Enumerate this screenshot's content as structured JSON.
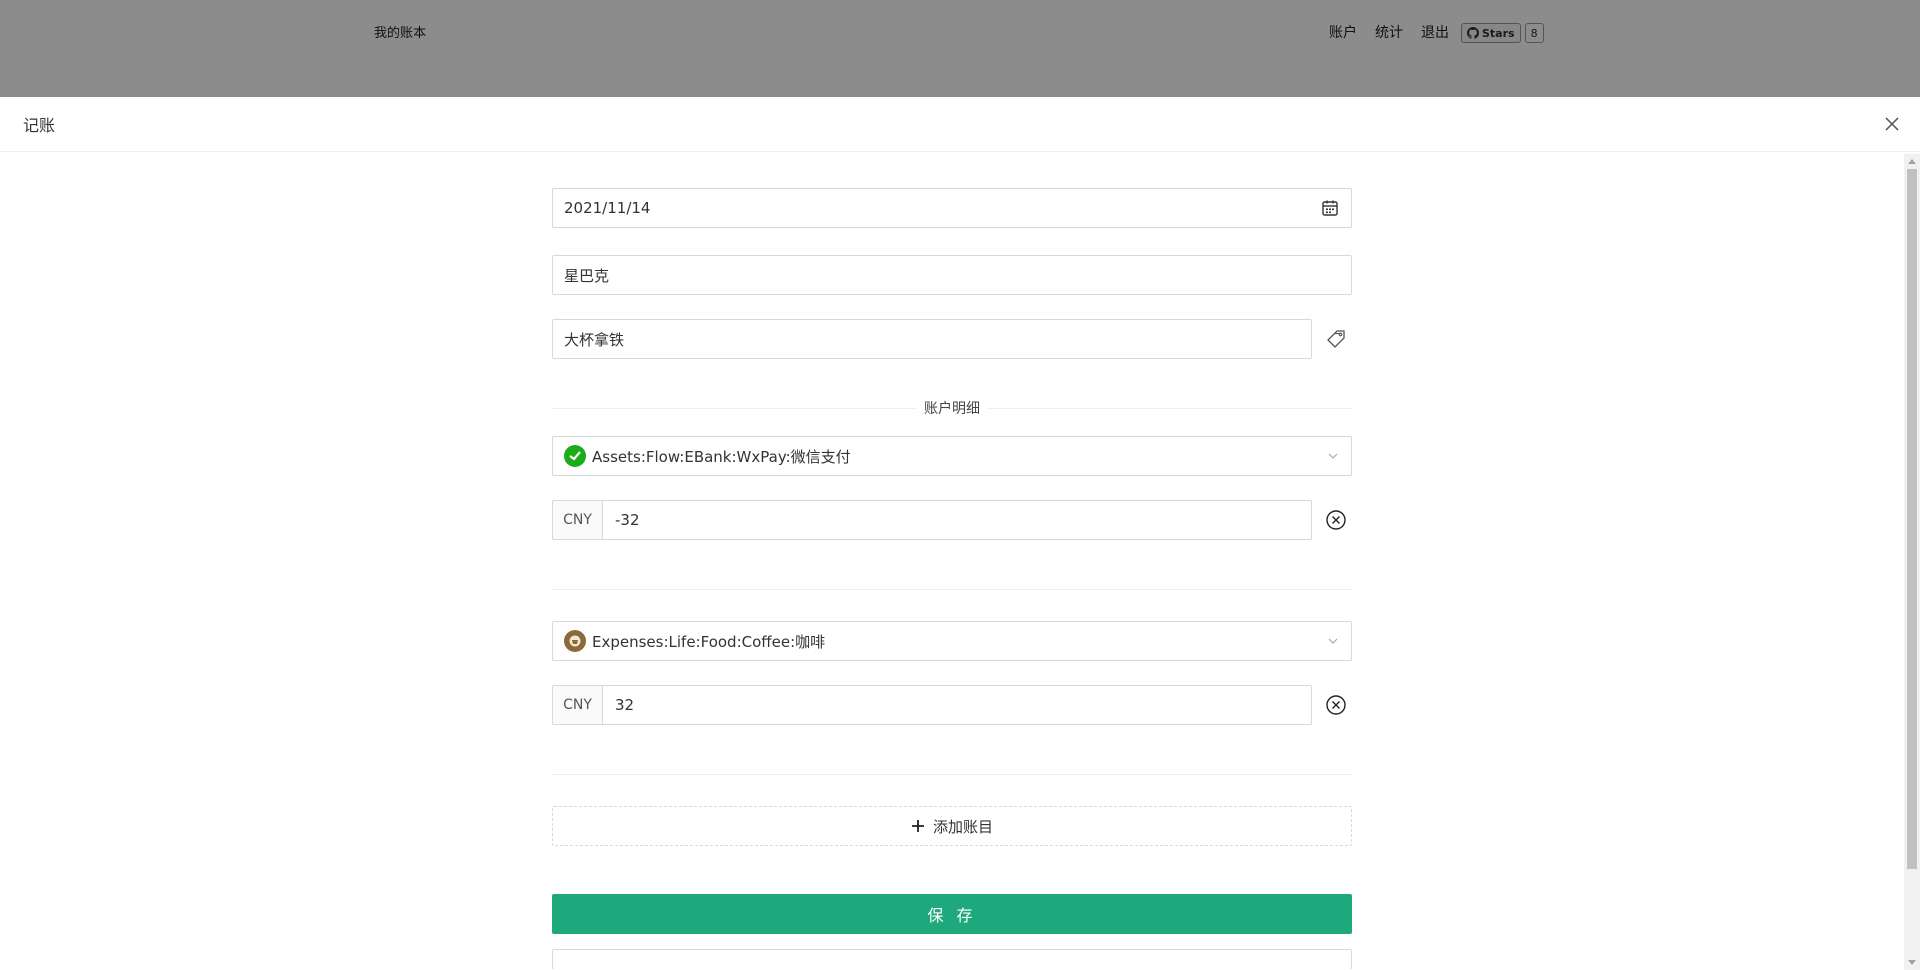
{
  "bg_nav": {
    "brand": "我的账本",
    "links": [
      "账户",
      "统计",
      "退出"
    ],
    "github": {
      "stars_label": "Stars",
      "count": "8"
    }
  },
  "drawer": {
    "title": "记账",
    "date": "2021/11/14",
    "payee": "星巴克",
    "narration": "大杯拿铁",
    "details_label": "账户明细",
    "entries": [
      {
        "account": "Assets:Flow:EBank:WxPay:微信支付",
        "currency": "CNY",
        "amount": "-32",
        "icon": "wechat-pay-icon",
        "icon_color": "#1aad19"
      },
      {
        "account": "Expenses:Life:Food:Coffee:咖啡",
        "currency": "CNY",
        "amount": "32",
        "icon": "coffee-icon",
        "icon_color": "#8b6a3a"
      }
    ],
    "add_label": "添加账目",
    "save_label": "保 存"
  },
  "colors": {
    "primary": "#1ea97c",
    "border": "#d9d9d9"
  }
}
